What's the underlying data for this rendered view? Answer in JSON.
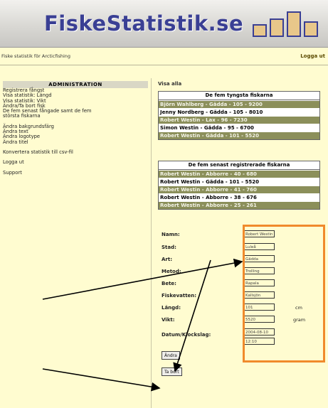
{
  "header": {
    "logo_text": "FiskeStatistik.se",
    "tagline": "Fiske statistik för Arcticfishing",
    "logout_label": "Logga ut"
  },
  "sidebar": {
    "title": "ADMINISTRATION",
    "items": [
      "Registrera fångst",
      "Visa statistik: Längd",
      "Visa statistik: Vikt",
      "Ändra/Ta bort fisk",
      "De fem senast fångade samt de fem",
      "största fiskarna",
      "Ändra bakgrundsfärg",
      "Ändra text",
      "Ändra logotype",
      "Ändra titel",
      "Konvertera statistik till csv-fil",
      "Logga ut",
      "Support"
    ]
  },
  "main": {
    "show_all_label": "Visa alla",
    "heaviest": {
      "title": "De fem tyngsta fiskarna",
      "rows": [
        "Björn Wahlberg - Gädda - 105 - 9200",
        "Jenny Nordberg - Gädda - 105 - 8010",
        "Robert Westin - Lax - 96 - 7230",
        "Simon Westin - Gädda - 95 - 6700",
        "Robert Westin - Gädda - 101 - 5520"
      ]
    },
    "latest": {
      "title": "De fem senast registrerade fiskarna",
      "rows": [
        "Robert Westin - Abborre - 40 - 680",
        "Robert Westin - Gädda - 101 - 5520",
        "Robert Westin - Abborre - 41 - 760",
        "Robert Westin - Abborre - 38 - 676",
        "Robert Westin - Abborre - 25 - 261"
      ]
    }
  },
  "form": {
    "name_label": "Namn:",
    "name_value": "Robert Westin",
    "city_label": "Stad:",
    "city_value": "Luleå",
    "species_label": "Art:",
    "species_value": "Gädda",
    "method_label": "Metod:",
    "method_value": "Trolling",
    "bait_label": "Bete:",
    "bait_value": "Rapala",
    "water_label": "Fiskevatten:",
    "water_value": "Kallsjön",
    "length_label": "Längd:",
    "length_value": "101",
    "length_unit": "cm",
    "weight_label": "Vikt:",
    "weight_value": "5520",
    "weight_unit": "gram",
    "datetime_label": "Datum/Klockslag:",
    "date_value": "2004-08-10",
    "time_value": "12:10",
    "change_button": "Ändra",
    "delete_button": "Ta bort"
  },
  "colors": {
    "background": "#fffcd0",
    "logo": "#3a3f94",
    "row_dark": "#8b8f5a",
    "highlight": "#f08a2c"
  }
}
